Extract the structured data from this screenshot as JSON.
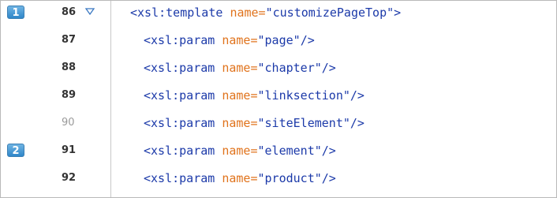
{
  "editor": {
    "lines": [
      {
        "number": "86",
        "marker": "1",
        "fold": true,
        "faded": false,
        "tag_open": "<xsl:template ",
        "attr": "name=",
        "value": "\"customizePageTop\"",
        "tag_close": ">"
      },
      {
        "number": "87",
        "marker": "",
        "fold": false,
        "faded": false,
        "tag_open": "<xsl:param ",
        "attr": "name=",
        "value": "\"page\"",
        "tag_close": "/>"
      },
      {
        "number": "88",
        "marker": "",
        "fold": false,
        "faded": false,
        "tag_open": "<xsl:param ",
        "attr": "name=",
        "value": "\"chapter\"",
        "tag_close": "/>"
      },
      {
        "number": "89",
        "marker": "",
        "fold": false,
        "faded": false,
        "tag_open": "<xsl:param ",
        "attr": "name=",
        "value": "\"linksection\"",
        "tag_close": "/>"
      },
      {
        "number": "90",
        "marker": "",
        "fold": false,
        "faded": true,
        "tag_open": "<xsl:param ",
        "attr": "name=",
        "value": "\"siteElement\"",
        "tag_close": "/>"
      },
      {
        "number": "91",
        "marker": "2",
        "fold": false,
        "faded": false,
        "tag_open": "<xsl:param ",
        "attr": "name=",
        "value": "\"element\"",
        "tag_close": "/>"
      },
      {
        "number": "92",
        "marker": "",
        "fold": false,
        "faded": false,
        "tag_open": "<xsl:param ",
        "attr": "name=",
        "value": "\"product\"",
        "tag_close": "/>"
      }
    ]
  },
  "colors": {
    "tag": "#1c3aa9",
    "attribute": "#e0731c",
    "marker": "#2f86c9"
  },
  "icons": {
    "fold": "fold-triangle-icon",
    "marker": "step-marker"
  }
}
